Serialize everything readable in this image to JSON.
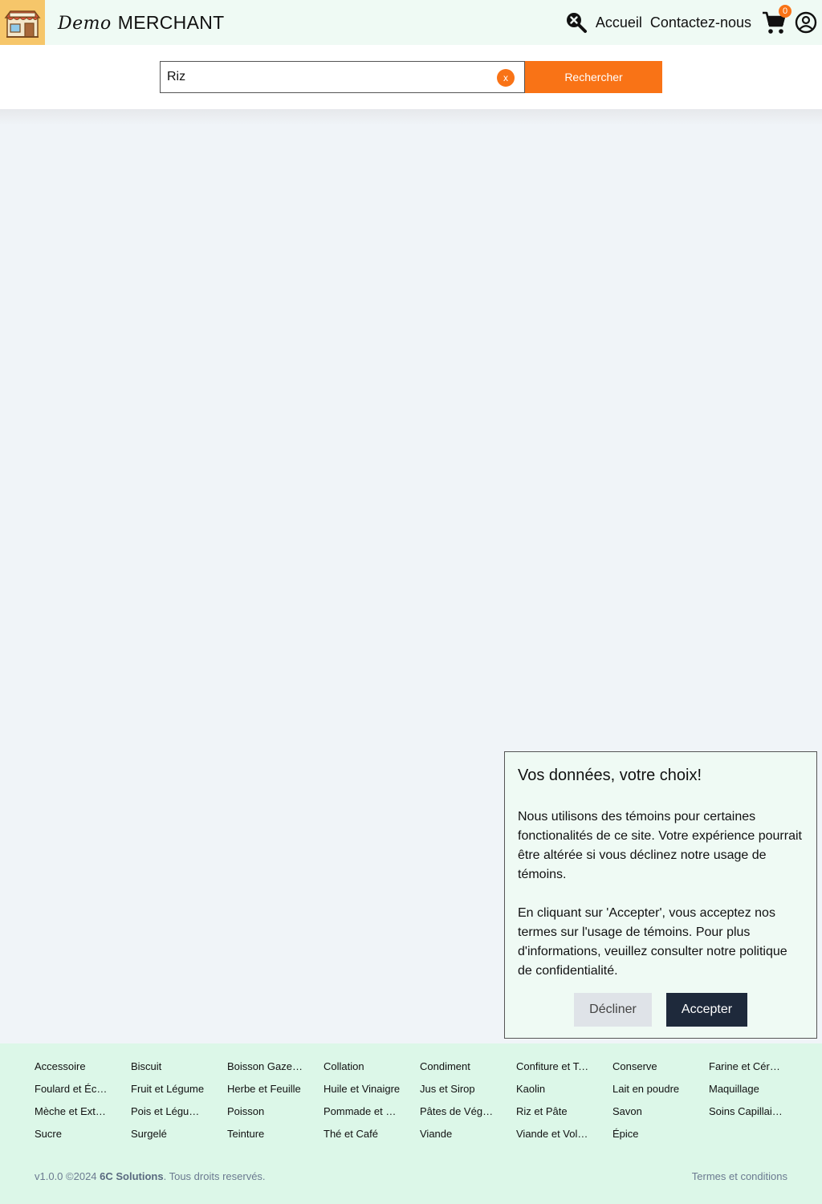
{
  "header": {
    "brand_script": "Demo",
    "brand_name": "MERCHANT",
    "nav": {
      "home": "Accueil",
      "contact": "Contactez-nous"
    },
    "cart_count": "0"
  },
  "search": {
    "value": "Riz",
    "clear_label": "x",
    "button_label": "Rechercher"
  },
  "cookie": {
    "title": "Vos données, votre choix!",
    "paragraph1": "Nous utilisons des témoins pour certaines fonctionalités de ce site. Votre expérience pourrait être altérée si vous déclinez notre usage de témoins.",
    "paragraph2": "En cliquant sur 'Accepter', vous acceptez nos termes sur l'usage de témoins. Pour plus d'informations, veuillez consulter notre politique de confidentialité.",
    "decline": "Décliner",
    "accept": "Accepter"
  },
  "footer": {
    "categories": [
      "Accessoire",
      "Biscuit",
      "Boisson Gazeuse",
      "Collation",
      "Condiment",
      "Confiture et Tartinade",
      "Conserve",
      "Farine et Céréale",
      "Foulard et Écharpe",
      "Fruit et Légume",
      "Herbe et Feuille",
      "Huile et Vinaigre",
      "Jus et Sirop",
      "Kaolin",
      "Lait en poudre",
      "Maquillage",
      "Mèche et Extension",
      "Pois et Légumineuse",
      "Poisson",
      "Pommade et Crème",
      "Pâtes de Végétaux",
      "Riz et Pâte",
      "Savon",
      "Soins Capillaires",
      "Sucre",
      "Surgelé",
      "Teinture",
      "Thé et Café",
      "Viande",
      "Viande et Volaille",
      "Épice"
    ],
    "version": "v1.0.0 ©2024",
    "company": "6C Solutions",
    "rights": ". Tous droits reservés.",
    "terms": "Termes et conditions"
  },
  "colors": {
    "accent": "#f97316",
    "header_bg": "#effaf4",
    "footer_bg": "#dcf7e8",
    "dark_button": "#1e293b"
  }
}
